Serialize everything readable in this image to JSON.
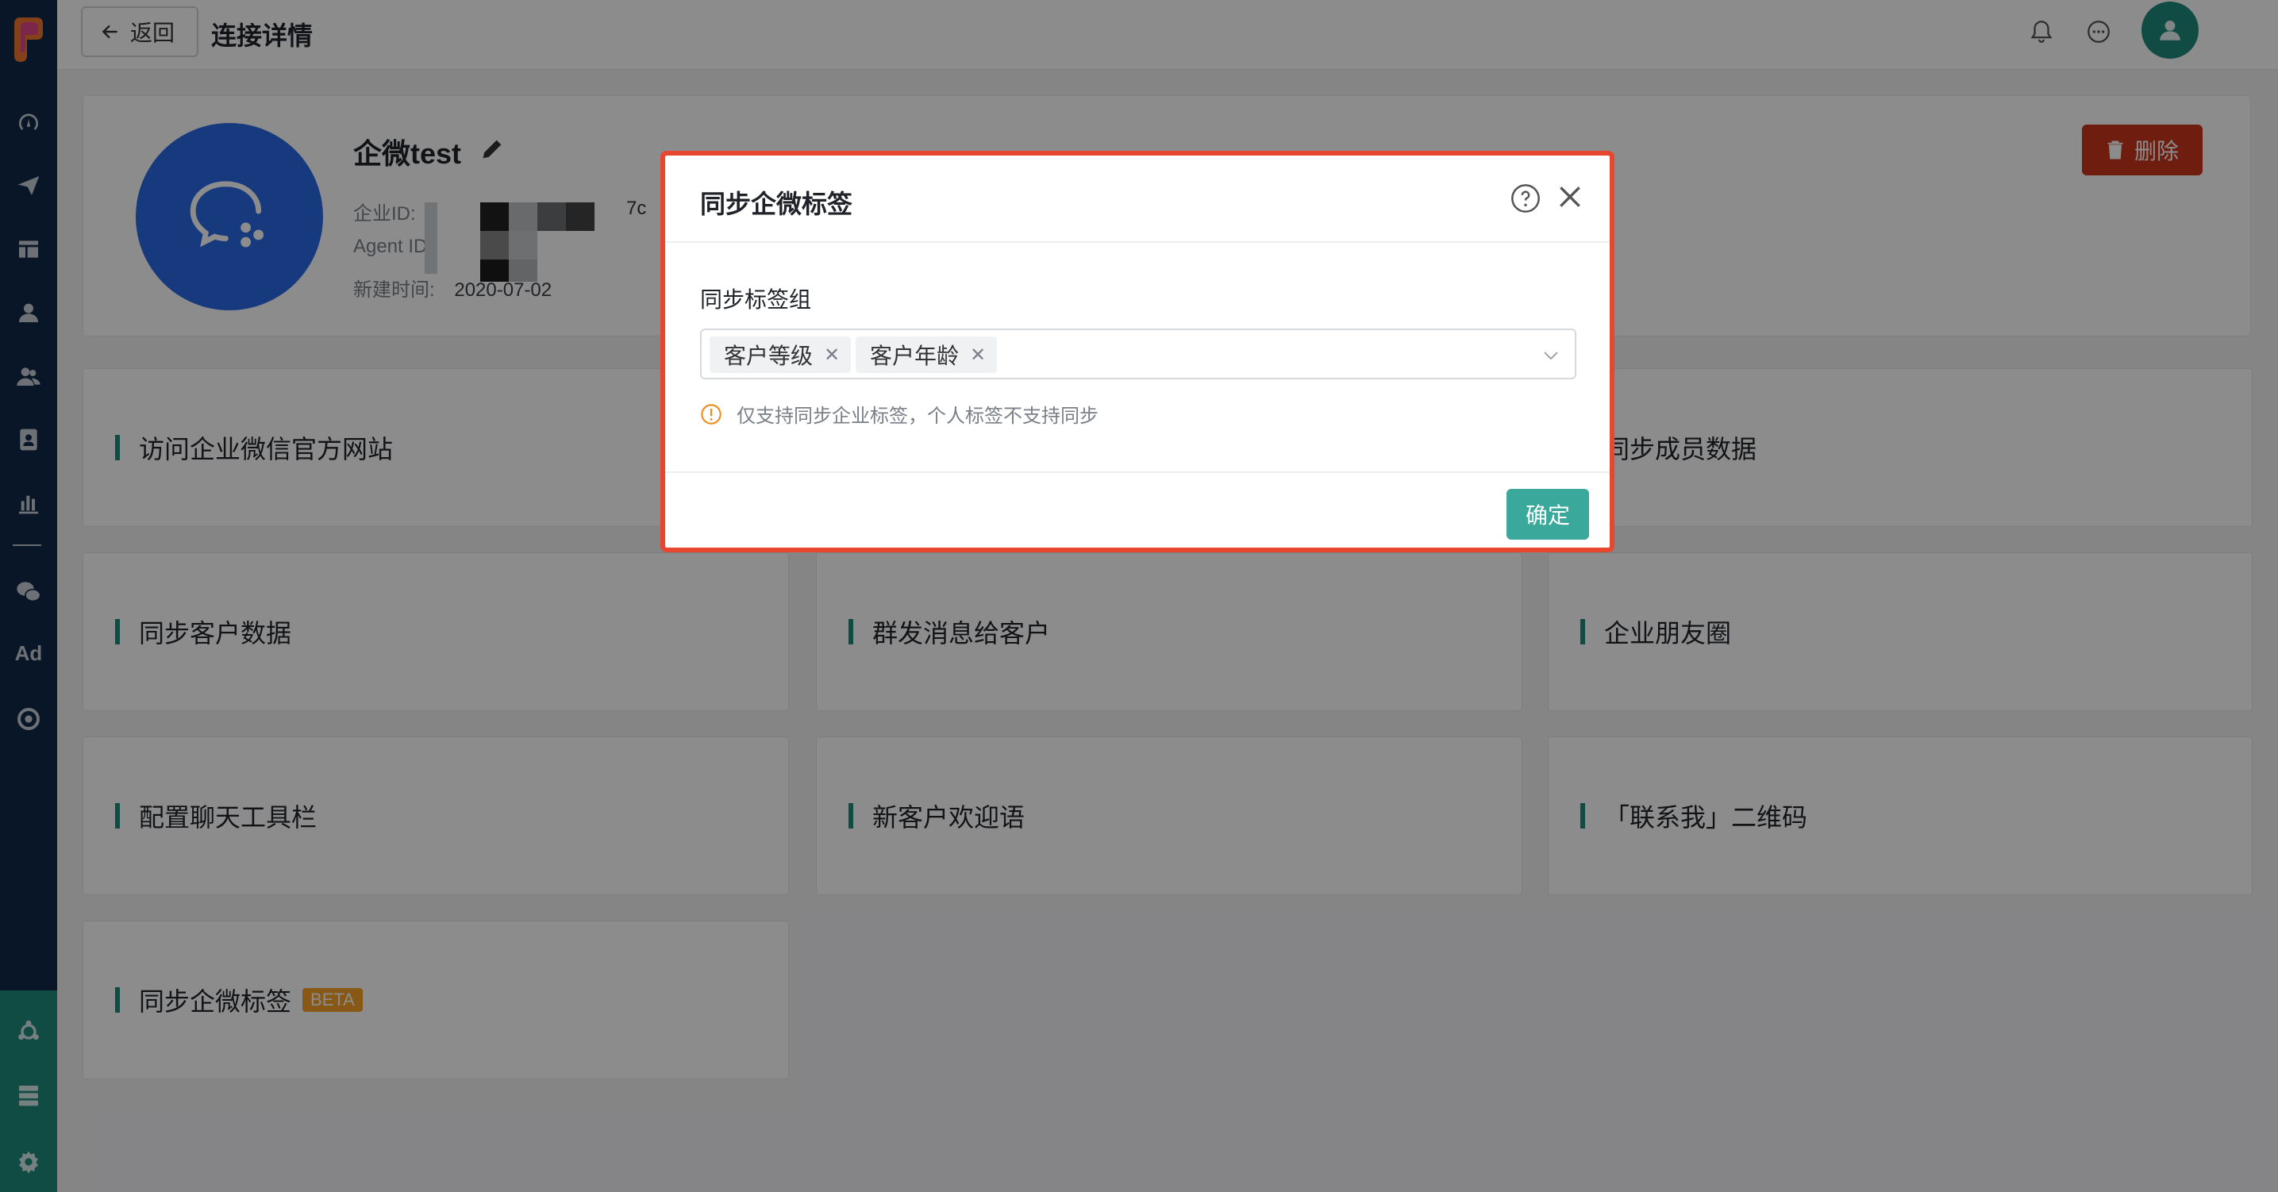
{
  "header": {
    "back_label": "返回",
    "page_title": "连接详情"
  },
  "sidebar": {
    "ad_label": "Ad"
  },
  "profile": {
    "name": "企微test",
    "corp_id_label": "企业ID:",
    "corp_id_suffix": "7c",
    "agent_id_label": "Agent ID:",
    "created_label": "新建时间:",
    "created_value": "2020-07-02",
    "delete_label": "删除"
  },
  "tiles": [
    {
      "label": "访问企业微信官方网站"
    },
    {
      "label": "同步成员数据"
    },
    {
      "label": "同步客户数据"
    },
    {
      "label": "群发消息给客户"
    },
    {
      "label": "企业朋友圈"
    },
    {
      "label": "配置聊天工具栏"
    },
    {
      "label": "新客户欢迎语"
    },
    {
      "label": "「联系我」二维码"
    },
    {
      "label": "同步企微标签",
      "badge": "BETA"
    }
  ],
  "modal": {
    "title": "同步企微标签",
    "field_label": "同步标签组",
    "tags": [
      "客户等级",
      "客户年龄"
    ],
    "hint": "仅支持同步企业标签，个人标签不支持同步",
    "confirm_label": "确定"
  },
  "colors": {
    "sidebar": "#10294a",
    "accent": "#1f8a7c",
    "delete": "#c8361b",
    "highlight_border": "#e8472f",
    "beta": "#f7a128"
  }
}
